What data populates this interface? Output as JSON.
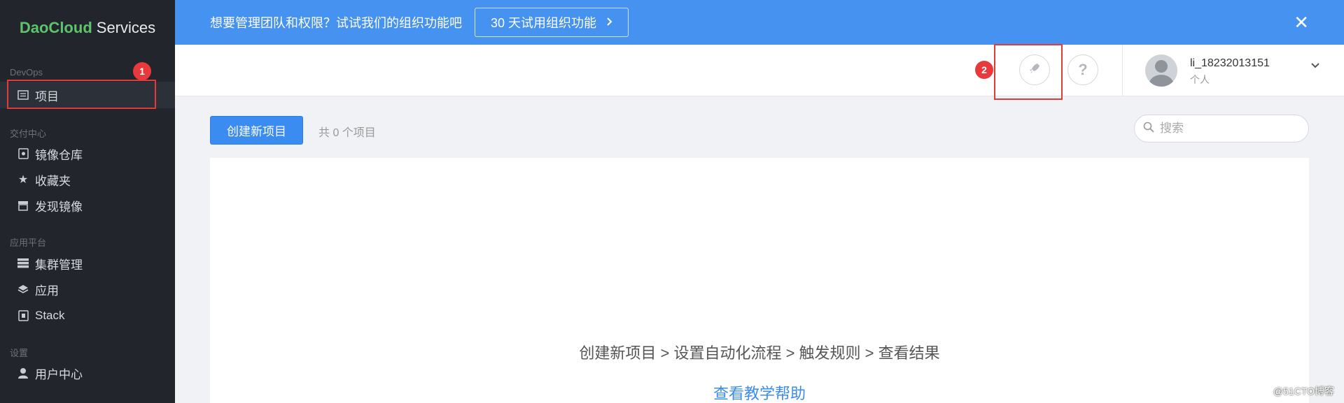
{
  "brand": {
    "part1": "DaoCloud",
    "part2": "Services"
  },
  "sidebar": {
    "sections": [
      {
        "title": "DevOps",
        "items": [
          {
            "label": "项目",
            "icon": "project-icon"
          }
        ]
      },
      {
        "title": "交付中心",
        "items": [
          {
            "label": "镜像仓库",
            "icon": "image-repo-icon"
          },
          {
            "label": "收藏夹",
            "icon": "star-icon"
          },
          {
            "label": "发现镜像",
            "icon": "store-icon"
          }
        ]
      },
      {
        "title": "应用平台",
        "items": [
          {
            "label": "集群管理",
            "icon": "cluster-icon"
          },
          {
            "label": "应用",
            "icon": "layers-icon"
          },
          {
            "label": "Stack",
            "icon": "stack-icon"
          }
        ]
      },
      {
        "title": "设置",
        "items": [
          {
            "label": "用户中心",
            "icon": "user-icon"
          }
        ]
      }
    ]
  },
  "badges": {
    "one": "1",
    "two": "2"
  },
  "banner": {
    "text": "想要管理团队和权限？试试我们的组织功能吧",
    "button": "30 天试用组织功能",
    "close": "✕"
  },
  "header": {
    "username": "li_18232013151",
    "usertype": "个人"
  },
  "toolbar": {
    "create_label": "创建新项目",
    "count_text": "共 0 个项目",
    "search_placeholder": "搜索"
  },
  "content": {
    "steps": "创建新项目 > 设置自动化流程 > 触发规则 > 查看结果",
    "help_link": "查看教学帮助"
  },
  "watermark": "@51CTO博客",
  "colors": {
    "accent": "#3b8cf0",
    "banner": "#4592f0",
    "sidebar": "#22252b",
    "highlight": "#e03a3a"
  }
}
